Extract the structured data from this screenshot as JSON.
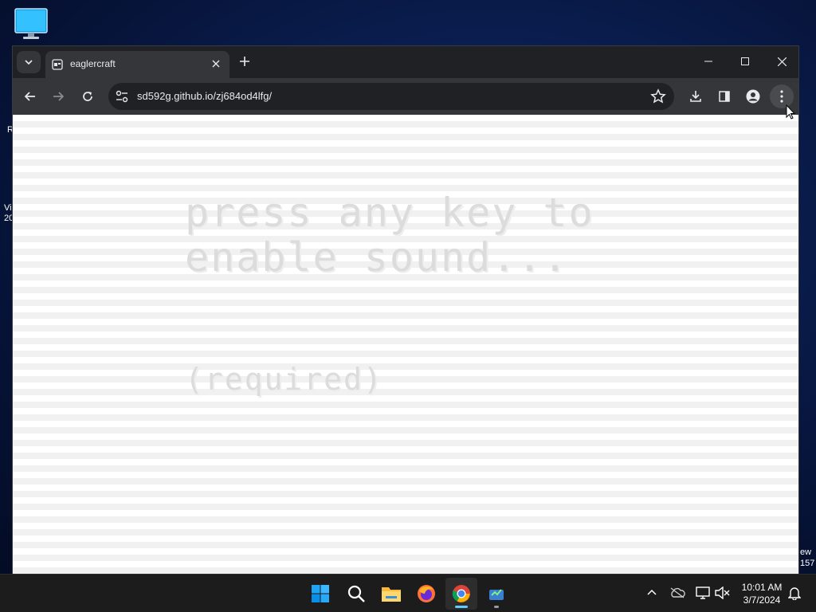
{
  "desktop": {
    "icon": "monitor-icon",
    "fragments": [
      "R",
      "Vi",
      "20",
      "ew",
      "157"
    ]
  },
  "browser": {
    "tab": {
      "title": "eaglercraft",
      "favicon": "page-favicon-icon"
    },
    "address": {
      "url": "sd592g.github.io/zj684od4lfg/"
    },
    "icons": {
      "back": "back-arrow-icon",
      "forward": "forward-arrow-icon",
      "reload": "reload-icon",
      "site_info": "site-info-icon",
      "bookmark": "star-icon",
      "downloads": "download-icon",
      "side_panel": "side-panel-icon",
      "profile": "profile-icon",
      "menu": "kebab-menu-icon"
    }
  },
  "page": {
    "message": "press any key to enable sound...",
    "required": "(required)"
  },
  "taskbar": {
    "apps": [
      "start-icon",
      "search-icon",
      "file-explorer-icon",
      "firefox-icon",
      "chrome-icon",
      "app-icon"
    ],
    "tray": [
      "chevron-up-icon",
      "onedrive-icon",
      "network-icon",
      "volume-mute-icon",
      "notification-bell-icon"
    ],
    "time": "10:01 AM",
    "date": "3/7/2024"
  },
  "colors": {
    "accent": "#60cdff",
    "toolbar": "#35363a",
    "tabbar": "#202124"
  }
}
